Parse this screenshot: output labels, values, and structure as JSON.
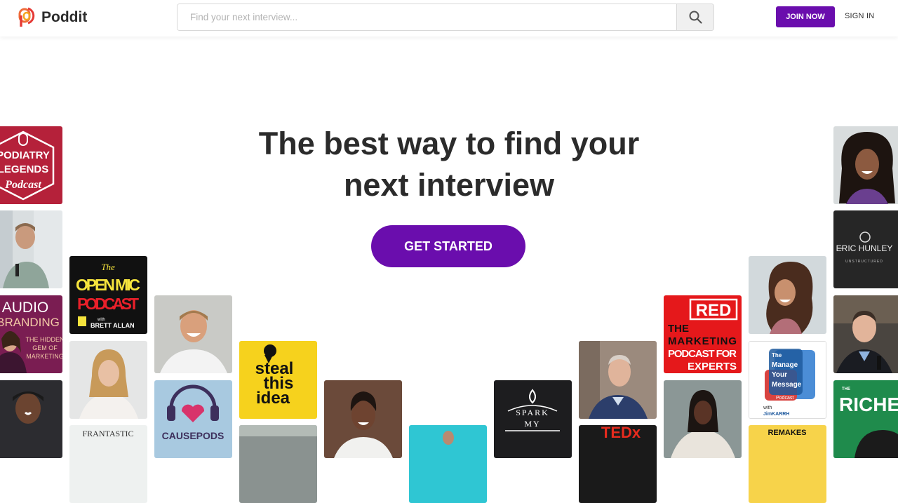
{
  "header": {
    "brand": "Poddit",
    "search_placeholder": "Find your next interview...",
    "join_label": "JOIN NOW",
    "signin_label": "SIGN IN"
  },
  "hero": {
    "title_line1": "The best way to find your",
    "title_line2": "next interview",
    "cta_label": "GET STARTED"
  },
  "tiles": {
    "podiatry": [
      "PODIATRY",
      "LEGENDS",
      "Podcast"
    ],
    "openmic": [
      "The",
      "OPEN MIC",
      "PODCAST",
      "with",
      "BRETT ALLAN"
    ],
    "audio": [
      "AUDIO",
      "BRANDING",
      "THE HIDDEN",
      "GEM OF",
      "MARKETING"
    ],
    "frantastic": "FRANTASTIC",
    "steal": [
      "steal",
      "this",
      "idea"
    ],
    "causepods": "CAUSEPODS",
    "spark": [
      "SPARK",
      "MY"
    ],
    "tedx": "TEDx",
    "red": [
      "RED",
      "THE",
      "MARKETING",
      "PODCAST FOR",
      "EXPERTS"
    ],
    "manage": [
      "The",
      "Manage",
      "Your",
      "Message",
      "Podcast",
      "with",
      "JimKARRH"
    ],
    "remakes": "REMAKES",
    "eric": [
      "ERIC HUNLEY",
      "UNSTRUCTURED"
    ],
    "richer": "RICHER"
  },
  "colors": {
    "brand": "#6a0dad",
    "podiatry": "#b5213a",
    "red": "#e5181b",
    "steal": "#f6d21d"
  }
}
